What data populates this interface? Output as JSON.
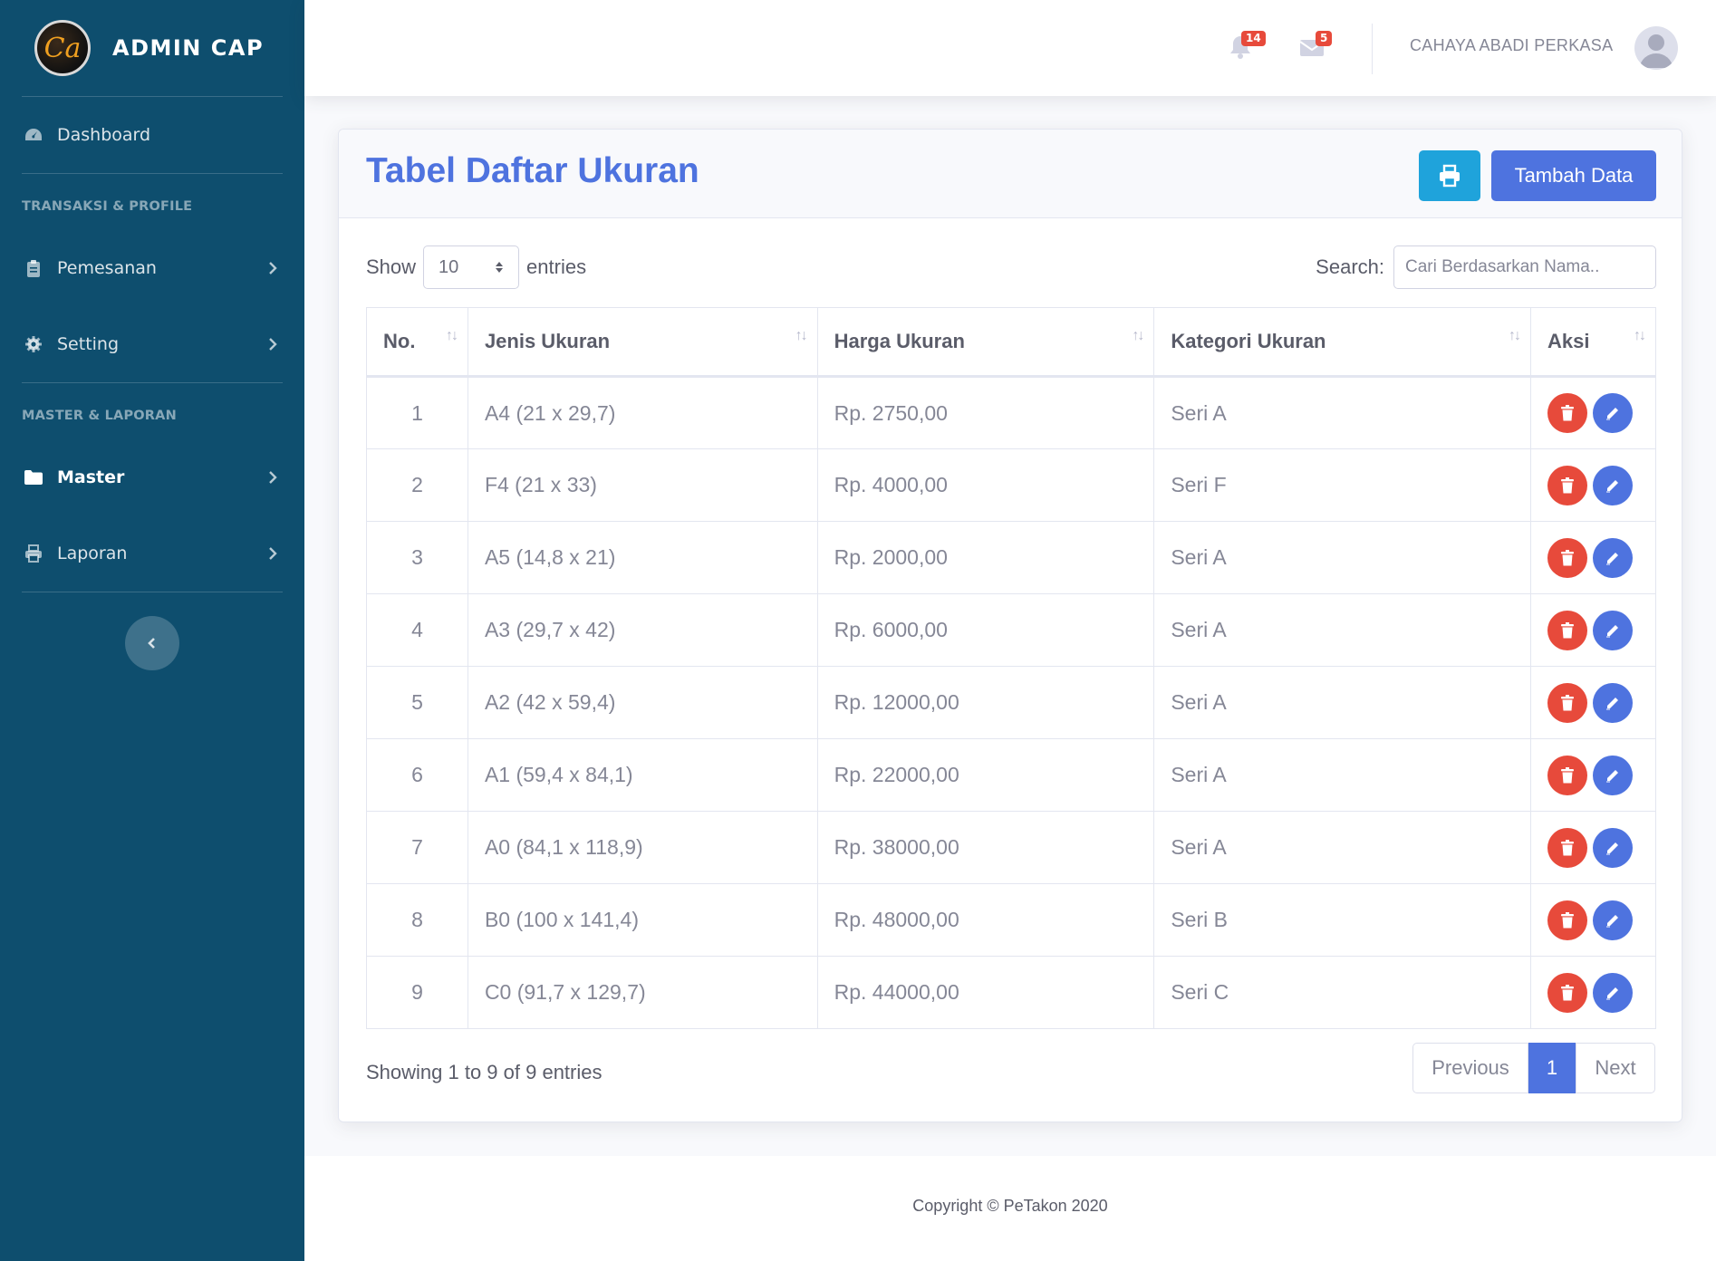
{
  "brand": {
    "logo_text": "Ca",
    "name": "ADMIN CAP"
  },
  "sidebar": {
    "dashboard": "Dashboard",
    "heading_1": "TRANSAKSI & PROFILE",
    "pemesanan": "Pemesanan",
    "setting": "Setting",
    "heading_2": "MASTER & LAPORAN",
    "master": "Master",
    "laporan": "Laporan"
  },
  "topbar": {
    "alerts_count": "14",
    "messages_count": "5",
    "user_name": "CAHAYA ABADI PERKASA"
  },
  "card": {
    "title": "Tabel Daftar Ukuran",
    "add_button": "Tambah Data"
  },
  "controls": {
    "show_label": "Show",
    "entries_value": "10",
    "entries_label": "entries",
    "search_label": "Search:",
    "search_placeholder": "Cari Berdasarkan Nama.."
  },
  "table": {
    "headers": [
      "No.",
      "Jenis Ukuran",
      "Harga Ukuran",
      "Kategori Ukuran",
      "Aksi"
    ],
    "rows": [
      [
        "1",
        "A4 (21 x 29,7)",
        "Rp. 2750,00",
        "Seri A"
      ],
      [
        "2",
        "F4 (21 x 33)",
        "Rp. 4000,00",
        "Seri F"
      ],
      [
        "3",
        "A5 (14,8 x 21)",
        "Rp. 2000,00",
        "Seri A"
      ],
      [
        "4",
        "A3 (29,7 x 42)",
        "Rp. 6000,00",
        "Seri A"
      ],
      [
        "5",
        "A2 (42 x 59,4)",
        "Rp. 12000,00",
        "Seri A"
      ],
      [
        "6",
        "A1 (59,4 x 84,1)",
        "Rp. 22000,00",
        "Seri A"
      ],
      [
        "7",
        "A0 (84,1 x 118,9)",
        "Rp. 38000,00",
        "Seri A"
      ],
      [
        "8",
        "B0 (100 x 141,4)",
        "Rp. 48000,00",
        "Seri B"
      ],
      [
        "9",
        "C0 (91,7 x 129,7)",
        "Rp. 44000,00",
        "Seri C"
      ]
    ]
  },
  "pagination": {
    "info": "Showing 1 to 9 of 9 entries",
    "previous": "Previous",
    "current": "1",
    "next": "Next"
  },
  "footer": {
    "copyright": "Copyright © PeTakon 2020"
  },
  "colors": {
    "sidebar": "#0e4e6e",
    "primary": "#4e73df",
    "info": "#1fa3db",
    "danger": "#e74a3b"
  }
}
